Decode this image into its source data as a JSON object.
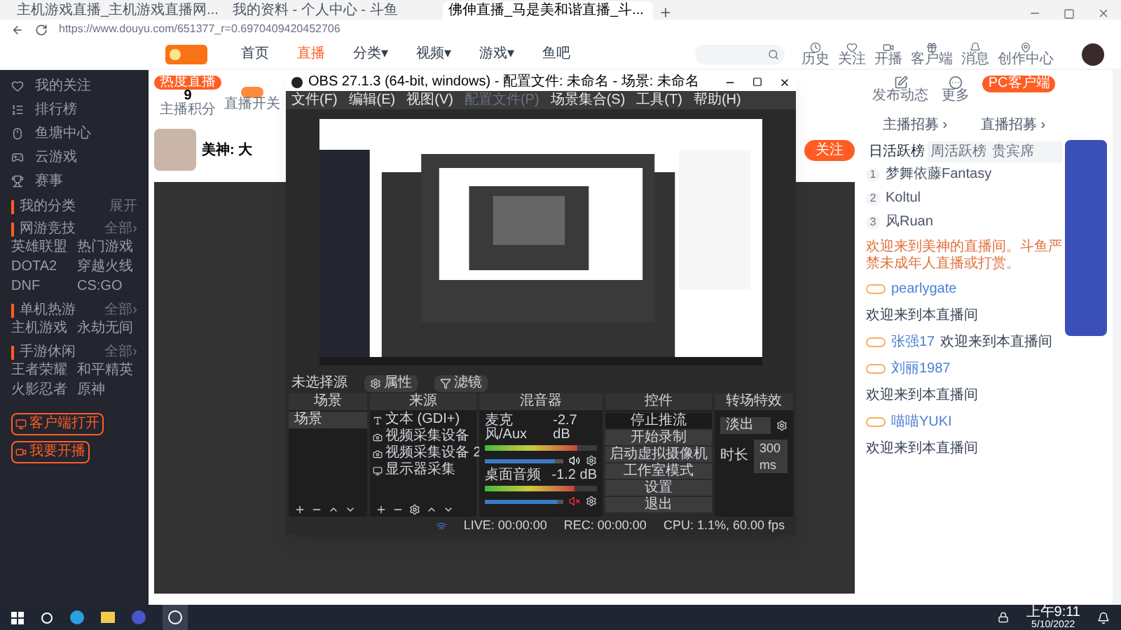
{
  "browser": {
    "tabs": [
      {
        "title": "主机游戏直播_主机游戏直播网...",
        "selected": false
      },
      {
        "title": "我的资料 - 个人中心 - 斗鱼",
        "selected": false
      },
      {
        "title": "佛伸直播_马是美和谐直播_斗...",
        "selected": true
      }
    ],
    "url": "https://www.douyu.com/651377_r=0.6970409420452706"
  },
  "site": {
    "nav": [
      {
        "label": "首页",
        "selected": false
      },
      {
        "label": "直播",
        "selected": true
      },
      {
        "label": "分类▾",
        "selected": false
      },
      {
        "label": "视频▾",
        "selected": false
      },
      {
        "label": "游戏▾",
        "selected": false
      },
      {
        "label": "鱼吧",
        "selected": false
      }
    ],
    "header_icons": [
      {
        "kind": "clock",
        "label": "历史"
      },
      {
        "kind": "heart",
        "label": "关注"
      },
      {
        "kind": "video",
        "label": "开播"
      },
      {
        "kind": "gift",
        "label": "客户端"
      },
      {
        "kind": "bell",
        "label": "消息"
      },
      {
        "kind": "pin",
        "label": "创作中心"
      }
    ]
  },
  "sidebar": {
    "items": [
      {
        "kind": "heart",
        "label": "我的关注"
      },
      {
        "kind": "list",
        "label": "排行榜"
      },
      {
        "kind": "mouse",
        "label": "鱼塘中心"
      },
      {
        "kind": "gamepad",
        "label": "云游戏"
      },
      {
        "kind": "trophy",
        "label": "赛事"
      }
    ],
    "my_category": {
      "title": "我的分类",
      "more": "展开"
    },
    "sections": [
      {
        "title": "网游竞技",
        "more": "全部›",
        "games": [
          "英雄联盟",
          "热门游戏",
          "DOTA2",
          "穿越火线",
          "DNF",
          "CS:GO"
        ]
      },
      {
        "title": "单机热游",
        "more": "全部›",
        "games": [
          "主机游戏",
          "永劫无间"
        ]
      },
      {
        "title": "手游休闲",
        "more": "全部›",
        "games": [
          "王者荣耀",
          "和平精英",
          "火影忍者",
          "原神"
        ]
      }
    ],
    "buttons": [
      {
        "kind": "monitor",
        "label": "客户端打开"
      },
      {
        "kind": "camera",
        "label": "我要开播"
      }
    ]
  },
  "room": {
    "badge": "热度直播",
    "stat_value": "9",
    "stat_label": "主播积分",
    "toggle_label": "直播开关",
    "toggle_on": true,
    "streamer_name": "美神: 大",
    "follow": "关注"
  },
  "obs": {
    "title": "OBS 27.1.3 (64-bit, windows) - 配置文件: 未命名 - 场景: 未命名",
    "menu": [
      {
        "label": "文件(F)",
        "disabled": false
      },
      {
        "label": "编辑(E)",
        "disabled": false
      },
      {
        "label": "视图(V)",
        "disabled": false
      },
      {
        "label": "配置文件(P)",
        "disabled": true
      },
      {
        "label": "场景集合(S)",
        "disabled": false
      },
      {
        "label": "工具(T)",
        "disabled": false
      },
      {
        "label": "帮助(H)",
        "disabled": false
      }
    ],
    "source_label": "未选择源",
    "source_buttons": [
      {
        "kind": "gear",
        "label": "属性"
      },
      {
        "kind": "filter",
        "label": "滤镜"
      }
    ],
    "docks": {
      "scenes": "场景",
      "sources": "来源",
      "mixer": "混音器",
      "controls": "控件",
      "transitions": "转场特效"
    },
    "scenes": [
      {
        "label": "场景",
        "selected": true
      }
    ],
    "sources": [
      {
        "kind": "text",
        "label": "文本 (GDI+)"
      },
      {
        "kind": "camera",
        "label": "视频采集设备"
      },
      {
        "kind": "camera",
        "label": "视频采集设备 2"
      },
      {
        "kind": "monitor",
        "label": "显示器采集"
      }
    ],
    "channels": [
      {
        "name": "麦克风/Aux",
        "reading": "-2.7 dB",
        "level": 0.82,
        "volume": {
          "level": 0.9
        },
        "muted": false
      },
      {
        "name": "桌面音频",
        "reading": "-1.2 dB",
        "level": 0.8,
        "volume": {
          "level": 0.92
        },
        "muted": true
      }
    ],
    "controls": [
      {
        "label": "停止推流",
        "selected": true
      },
      {
        "label": "开始录制",
        "selected": false
      },
      {
        "label": "启动虚拟摄像机",
        "selected": false
      },
      {
        "label": "工作室模式",
        "selected": false
      },
      {
        "label": "设置",
        "selected": false
      },
      {
        "label": "退出",
        "selected": false
      }
    ],
    "transition": {
      "value": "淡出",
      "duration_label": "时长",
      "duration": "300 ms"
    },
    "status": {
      "live": "LIVE: 00:00:00",
      "rec": "REC: 00:00:00",
      "cpu": "CPU: 1.1%, 60.00 fps"
    }
  },
  "right": {
    "actions": [
      {
        "kind": "edit",
        "label": "发布动态"
      },
      {
        "kind": "more",
        "label": "更多"
      }
    ],
    "pc_client": "PC客户端",
    "recruit": [
      "主播招募 ›",
      "直播招募 ›"
    ],
    "tabs": [
      {
        "label": "日活跃榜",
        "selected": true
      },
      {
        "label": "周活跃榜",
        "selected": false
      },
      {
        "label": "贵宾席",
        "selected": false
      }
    ],
    "ranks": [
      {
        "num": "1",
        "name": "梦舞依藤Fantasy"
      },
      {
        "num": "2",
        "name": "Koltul"
      },
      {
        "num": "3",
        "name": "风Ruan"
      }
    ],
    "notice": "欢迎来到美神的直播间。斗鱼严禁未成年人直播或打赏。",
    "chat": [
      {
        "user": "pearlygate",
        "text": "欢迎来到本直播间"
      },
      {
        "user": "张强17",
        "text": "欢迎来到本直播间"
      },
      {
        "user": "刘丽1987",
        "text": "欢迎来到本直播间"
      },
      {
        "user": "喵喵YUKI",
        "text": "欢迎来到本直播间"
      }
    ]
  },
  "taskbar": {
    "time": "上午9:11",
    "date": "5/10/2022"
  }
}
